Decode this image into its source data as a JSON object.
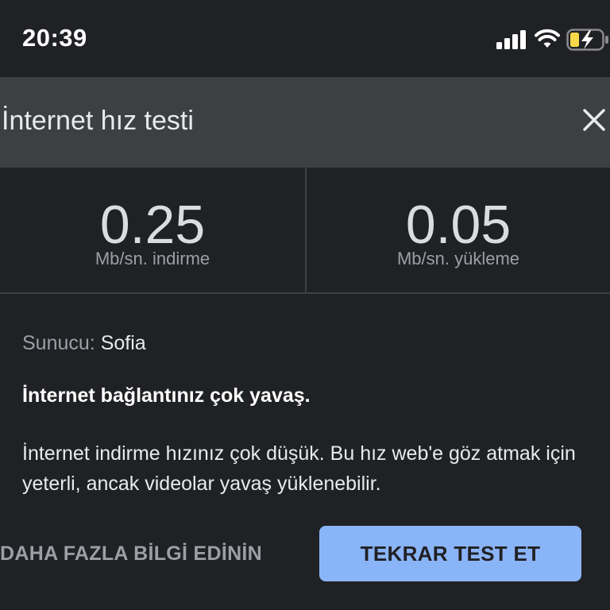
{
  "status_bar": {
    "time": "20:39",
    "icons": [
      "cellular-signal-icon",
      "wifi-icon",
      "battery-charging-icon"
    ],
    "battery_color": "#f9d849"
  },
  "header": {
    "title": "İnternet hız testi",
    "close_icon": "close-icon"
  },
  "results": {
    "download": {
      "value": "0.25",
      "label": "Mb/sn. indirme"
    },
    "upload": {
      "value": "0.05",
      "label": "Mb/sn. yükleme"
    }
  },
  "server": {
    "label": "Sunucu:",
    "value": "Sofia"
  },
  "status": {
    "title": "İnternet bağlantınız çok yavaş.",
    "description": "İnternet indirme hızınız çok düşük. Bu hız web'e göz atmak için yeterli, ancak videolar yavaş yüklenebilir."
  },
  "actions": {
    "learn_more": "DAHA FAZLA BİLGİ EDİNİN",
    "retest": "TEKRAR TEST ET"
  },
  "colors": {
    "background": "#202124",
    "header_background": "#3c4043",
    "accent": "#8ab4f8"
  }
}
